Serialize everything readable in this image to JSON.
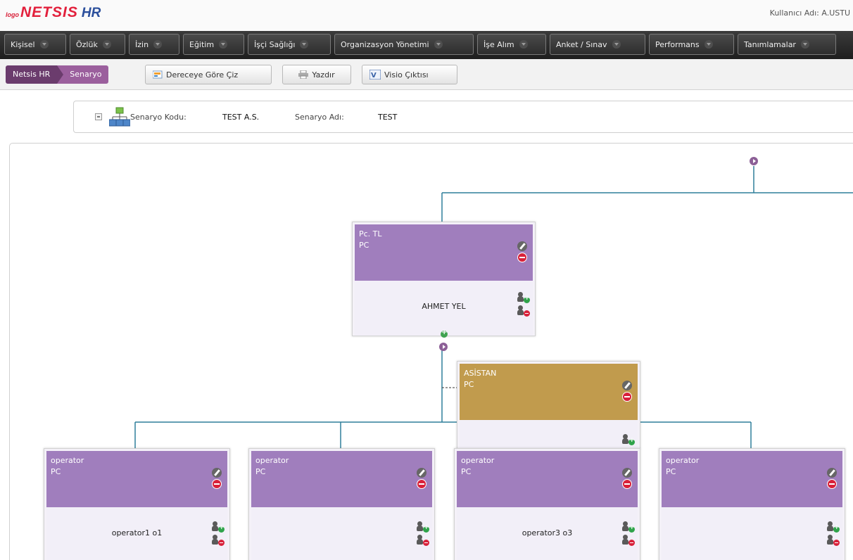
{
  "header": {
    "logo_small": "logo",
    "logo_main": "NETSIS",
    "logo_hr": "HR",
    "user_label": "Kullanıcı Adı: A.USTU"
  },
  "menu": [
    {
      "label": "Kişisel"
    },
    {
      "label": "Özlük"
    },
    {
      "label": "İzin"
    },
    {
      "label": "Eğitim"
    },
    {
      "label": "İşçi Sağlığı"
    },
    {
      "label": "Organizasyon Yönetimi"
    },
    {
      "label": "İşe Alım"
    },
    {
      "label": "Anket / Sınav"
    },
    {
      "label": "Performans"
    },
    {
      "label": "Tanımlamalar"
    }
  ],
  "breadcrumb": [
    "Netsis HR",
    "Senaryo"
  ],
  "toolbar": {
    "draw_by_grade": "Dereceye Göre Çiz",
    "print": "Yazdır",
    "visio": "Visio Çıktısı"
  },
  "scenario": {
    "code_label": "Senaryo Kodu:",
    "code_value": "TEST A.S.",
    "name_label": "Senaryo Adı:",
    "name_value": "TEST"
  },
  "nodes": {
    "root": {
      "title": "Pc. TL",
      "sub": "PC",
      "person": "AHMET YEL"
    },
    "assistant": {
      "title": "ASİSTAN",
      "sub": "PC",
      "person": ""
    },
    "op1": {
      "title": "operator",
      "sub": "PC",
      "person": "operator1 o1"
    },
    "op2": {
      "title": "operator",
      "sub": "PC",
      "person": ""
    },
    "op3": {
      "title": "operator",
      "sub": "PC",
      "person": "operator3 o3"
    },
    "op4": {
      "title": "operator",
      "sub": "PC",
      "person": ""
    }
  },
  "colors": {
    "node_purple": "#a07ebd",
    "node_gold": "#c19b4d",
    "connector": "#2f7f9a"
  }
}
